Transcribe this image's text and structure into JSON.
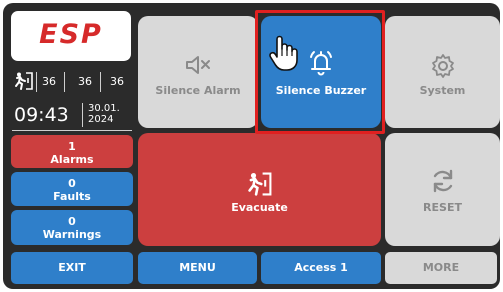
{
  "brand": {
    "logo_text": "ESP",
    "logo_color": "#d62a2a"
  },
  "status": {
    "counts": [
      "36",
      "36",
      "36"
    ],
    "time": "09:43",
    "date_line1": "30.01.",
    "date_line2": "2024"
  },
  "side": {
    "alarms": {
      "count": "1",
      "label": "Alarms",
      "color": "#cc3f3f"
    },
    "faults": {
      "count": "0",
      "label": "Faults",
      "color": "#2f7fca"
    },
    "warnings": {
      "count": "0",
      "label": "Warnings",
      "color": "#2f7fca"
    }
  },
  "tiles": {
    "silence_alarm": {
      "label": "Silence Alarm",
      "icon": "speaker-mute-icon"
    },
    "silence_buzzer": {
      "label": "Silence Buzzer",
      "icon": "bell-ringing-icon"
    },
    "system": {
      "label": "System",
      "icon": "gear-icon"
    },
    "evacuate": {
      "label": "Evacuate",
      "icon": "running-exit-icon"
    },
    "reset": {
      "label": "RESET",
      "icon": "refresh-icon"
    }
  },
  "bottom": {
    "exit": "EXIT",
    "menu": "MENU",
    "access": "Access 1",
    "more": "MORE"
  },
  "colors": {
    "panel": "#2b2b2b",
    "gray_tile": "#d9d9d9",
    "blue": "#2f7fca",
    "red": "#cc3f3f",
    "highlight": "#e02020"
  }
}
